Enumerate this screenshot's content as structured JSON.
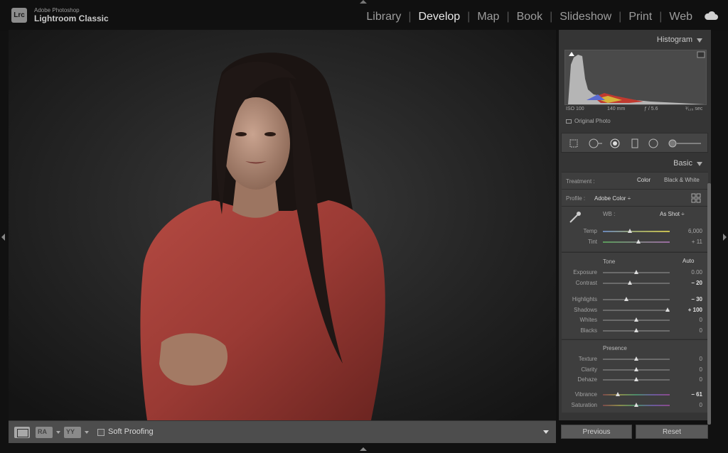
{
  "app": {
    "logo_text": "Lrc",
    "vendor": "Adobe Photoshop",
    "product": "Lightroom Classic"
  },
  "modules": [
    "Library",
    "Develop",
    "Map",
    "Book",
    "Slideshow",
    "Print",
    "Web"
  ],
  "active_module": "Develop",
  "toolbar": {
    "grid_label": "RA",
    "compare_label": "YY",
    "soft_proofing_label": "Soft Proofing"
  },
  "histogram": {
    "title": "Histogram",
    "iso": "ISO 100",
    "focal": "140 mm",
    "aperture": "ƒ / 5.6",
    "shutter": "¹⁄₁₂₅ sec",
    "original_photo_label": "Original Photo"
  },
  "basic": {
    "title": "Basic",
    "treatment_label": "Treatment :",
    "treatment_color": "Color",
    "treatment_bw": "Black & White",
    "profile_label": "Profile :",
    "profile_value": "Adobe Color ÷",
    "wb_label": "WB :",
    "wb_value": "As Shot ÷",
    "tone_label": "Tone",
    "auto_label": "Auto",
    "presence_label": "Presence"
  },
  "sliders": {
    "temp": {
      "label": "Temp",
      "value": "6,000",
      "pos": 0.4
    },
    "tint": {
      "label": "Tint",
      "value": "+ 11",
      "pos": 0.53
    },
    "exposure": {
      "label": "Exposure",
      "value": "0.00",
      "pos": 0.5
    },
    "contrast": {
      "label": "Contrast",
      "value": "− 20",
      "pos": 0.4
    },
    "highlights": {
      "label": "Highlights",
      "value": "− 30",
      "pos": 0.35
    },
    "shadows": {
      "label": "Shadows",
      "value": "+ 100",
      "pos": 0.97
    },
    "whites": {
      "label": "Whites",
      "value": "0",
      "pos": 0.5
    },
    "blacks": {
      "label": "Blacks",
      "value": "0",
      "pos": 0.5
    },
    "texture": {
      "label": "Texture",
      "value": "0",
      "pos": 0.5
    },
    "clarity": {
      "label": "Clarity",
      "value": "0",
      "pos": 0.5
    },
    "dehaze": {
      "label": "Dehaze",
      "value": "0",
      "pos": 0.5
    },
    "vibrance": {
      "label": "Vibrance",
      "value": "− 61",
      "pos": 0.22
    },
    "saturation": {
      "label": "Saturation",
      "value": "0",
      "pos": 0.5
    }
  },
  "footer": {
    "previous_label": "Previous",
    "reset_label": "Reset"
  }
}
